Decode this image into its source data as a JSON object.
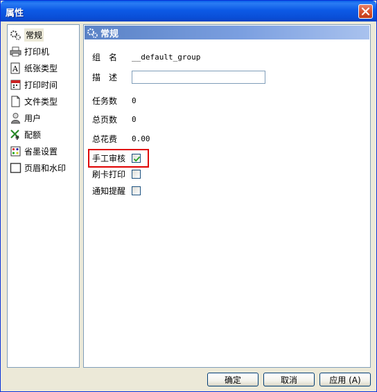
{
  "window": {
    "title": "属性"
  },
  "nav": {
    "items": [
      {
        "label": "常规",
        "icon": "gears-icon",
        "selected": true
      },
      {
        "label": "打印机",
        "icon": "printer-icon"
      },
      {
        "label": "纸张类型",
        "icon": "paper-icon"
      },
      {
        "label": "打印时间",
        "icon": "calendar-icon"
      },
      {
        "label": "文件类型",
        "icon": "file-icon"
      },
      {
        "label": "用户",
        "icon": "user-icon"
      },
      {
        "label": "配额",
        "icon": "quota-icon"
      },
      {
        "label": "省墨设置",
        "icon": "ink-icon"
      },
      {
        "label": "页眉和水印",
        "icon": "page-icon"
      }
    ]
  },
  "panel": {
    "header": "常规",
    "fields": {
      "group_name": {
        "label": "组　名",
        "value": "__default_group"
      },
      "description": {
        "label": "描　述",
        "value": ""
      },
      "task_count": {
        "label": "任务数",
        "value": "0"
      },
      "total_pages": {
        "label": "总页数",
        "value": "0"
      },
      "total_cost": {
        "label": "总花费",
        "value": "0.00"
      }
    },
    "checks": {
      "manual_review": {
        "label": "手工审核",
        "checked": true
      },
      "card_print": {
        "label": "刷卡打印",
        "checked": false
      },
      "notify": {
        "label": "通知提醒",
        "checked": false
      }
    }
  },
  "buttons": {
    "ok": "确定",
    "cancel": "取消",
    "apply": "应用 (A)"
  },
  "colors": {
    "title_blue": "#0a5fe9",
    "header_blue": "#5a82c6",
    "highlight_red": "#e00000"
  }
}
